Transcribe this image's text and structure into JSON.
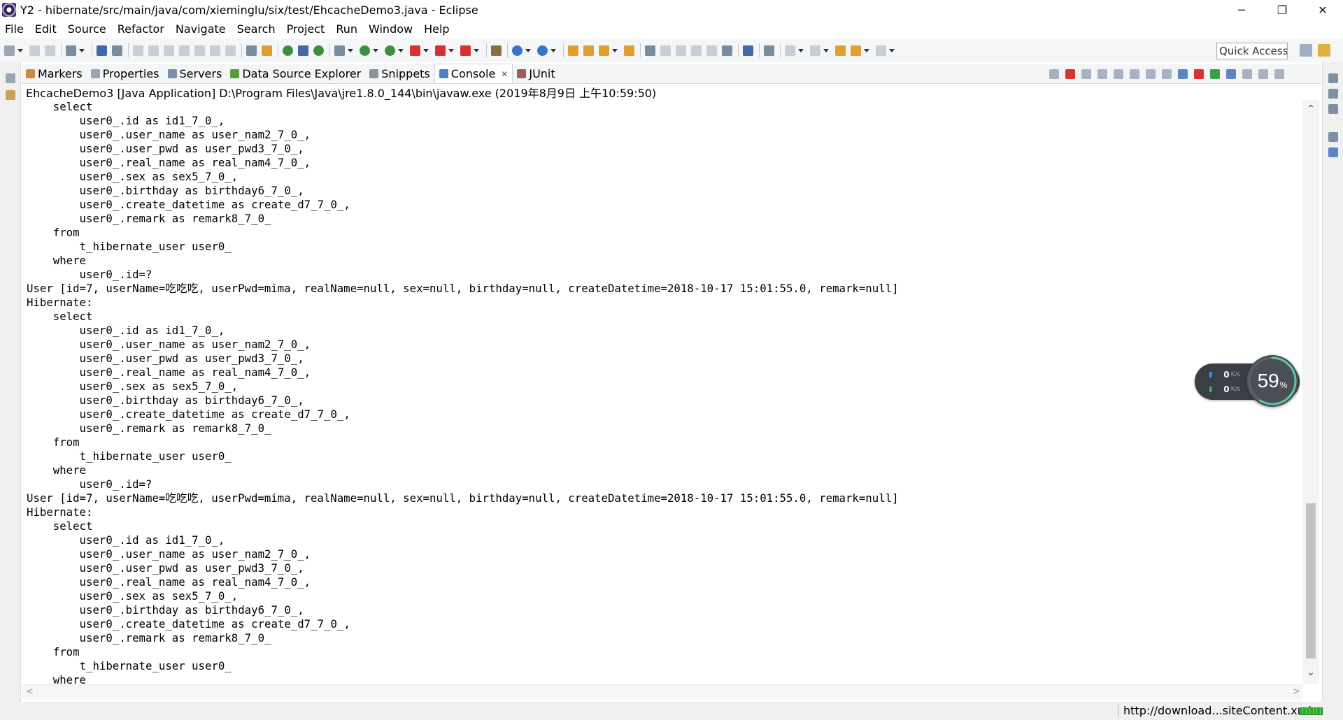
{
  "window": {
    "title": "Y2 - hibernate/src/main/java/com/xieminglu/six/test/EhcacheDemo3.java - Eclipse",
    "minimize": "─",
    "restore": "❐",
    "close": "✕"
  },
  "menu": [
    "File",
    "Edit",
    "Source",
    "Refactor",
    "Navigate",
    "Search",
    "Project",
    "Run",
    "Window",
    "Help"
  ],
  "toolbar": {
    "quick_access_placeholder": "Quick Access"
  },
  "views": {
    "tabs": [
      {
        "label": "Markers",
        "icon": "markers-icon"
      },
      {
        "label": "Properties",
        "icon": "properties-icon"
      },
      {
        "label": "Servers",
        "icon": "servers-icon"
      },
      {
        "label": "Data Source Explorer",
        "icon": "data-source-icon"
      },
      {
        "label": "Snippets",
        "icon": "snippets-icon"
      },
      {
        "label": "Console",
        "icon": "console-icon",
        "active": true
      },
      {
        "label": "JUnit",
        "icon": "junit-icon"
      }
    ],
    "close_glyph": "✕"
  },
  "console": {
    "header": "EhcacheDemo3 [Java Application] D:\\Program Files\\Java\\jre1.8.0_144\\bin\\javaw.exe (2019年8月9日 上午10:59:50)",
    "lines": [
      "    select",
      "        user0_.id as id1_7_0_,",
      "        user0_.user_name as user_nam2_7_0_,",
      "        user0_.user_pwd as user_pwd3_7_0_,",
      "        user0_.real_name as real_nam4_7_0_,",
      "        user0_.sex as sex5_7_0_,",
      "        user0_.birthday as birthday6_7_0_,",
      "        user0_.create_datetime as create_d7_7_0_,",
      "        user0_.remark as remark8_7_0_",
      "    from",
      "        t_hibernate_user user0_",
      "    where",
      "        user0_.id=?",
      "User [id=7, userName=吃吃吃, userPwd=mima, realName=null, sex=null, birthday=null, createDatetime=2018-10-17 15:01:55.0, remark=null]",
      "Hibernate:",
      "    select",
      "        user0_.id as id1_7_0_,",
      "        user0_.user_name as user_nam2_7_0_,",
      "        user0_.user_pwd as user_pwd3_7_0_,",
      "        user0_.real_name as real_nam4_7_0_,",
      "        user0_.sex as sex5_7_0_,",
      "        user0_.birthday as birthday6_7_0_,",
      "        user0_.create_datetime as create_d7_7_0_,",
      "        user0_.remark as remark8_7_0_",
      "    from",
      "        t_hibernate_user user0_",
      "    where",
      "        user0_.id=?",
      "User [id=7, userName=吃吃吃, userPwd=mima, realName=null, sex=null, birthday=null, createDatetime=2018-10-17 15:01:55.0, remark=null]",
      "Hibernate:",
      "    select",
      "        user0_.id as id1_7_0_,",
      "        user0_.user_name as user_nam2_7_0_,",
      "        user0_.user_pwd as user_pwd3_7_0_,",
      "        user0_.real_name as real_nam4_7_0_,",
      "        user0_.sex as sex5_7_0_,",
      "        user0_.birthday as birthday6_7_0_,",
      "        user0_.create_datetime as create_d7_7_0_,",
      "        user0_.remark as remark8_7_0_",
      "    from",
      "        t_hibernate_user user0_",
      "    where"
    ]
  },
  "scroll": {
    "up": "⌃",
    "down": "⌄",
    "left": "<",
    "right": ">"
  },
  "speed_widget": {
    "upload_arrow": "⬆",
    "download_arrow": "⬇",
    "upload_value": "0",
    "download_value": "0",
    "unit": "K/s",
    "percent_value": "59",
    "percent_sign": "%",
    "percent_fraction": 0.59,
    "upload_color": "#4aa3ff",
    "download_color": "#44cc66",
    "ring_color": "#5cc8a0"
  },
  "status": {
    "url": "http://download...siteContent.xml"
  }
}
